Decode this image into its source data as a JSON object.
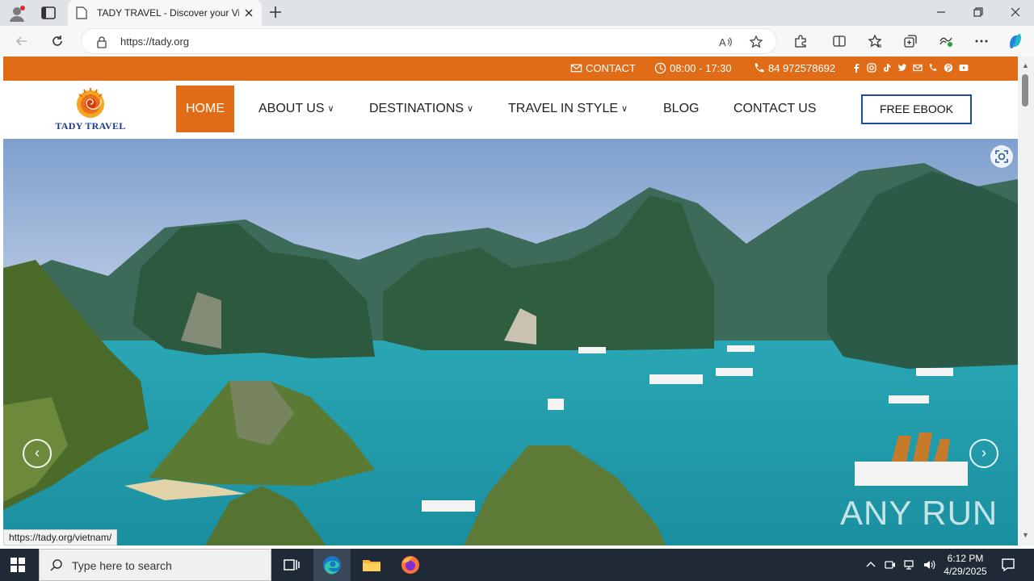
{
  "browser": {
    "tab_title": "TADY TRAVEL - Discover your Vie",
    "url": "https://tady.org",
    "status_url": "https://tady.org/vietnam/"
  },
  "site": {
    "topbar": {
      "contact": "CONTACT",
      "hours": "08:00 - 17:30",
      "phone": "84 972578692"
    },
    "logo_text": "TADY TRAVEL",
    "nav": {
      "home": "HOME",
      "about": "ABOUT US",
      "destinations": "DESTINATIONS",
      "travel_in_style": "TRAVEL IN STYLE",
      "blog": "BLOG",
      "contact": "CONTACT US"
    },
    "free_ebook": "FREE EBOOK",
    "watermark": "ANY RUN"
  },
  "taskbar": {
    "search_placeholder": "Type here to search",
    "time": "6:12 PM",
    "date": "4/29/2025"
  },
  "colors": {
    "brand_orange": "#e06c17",
    "ebook_border": "#1e4aa0",
    "taskbar": "#1f2a36"
  }
}
